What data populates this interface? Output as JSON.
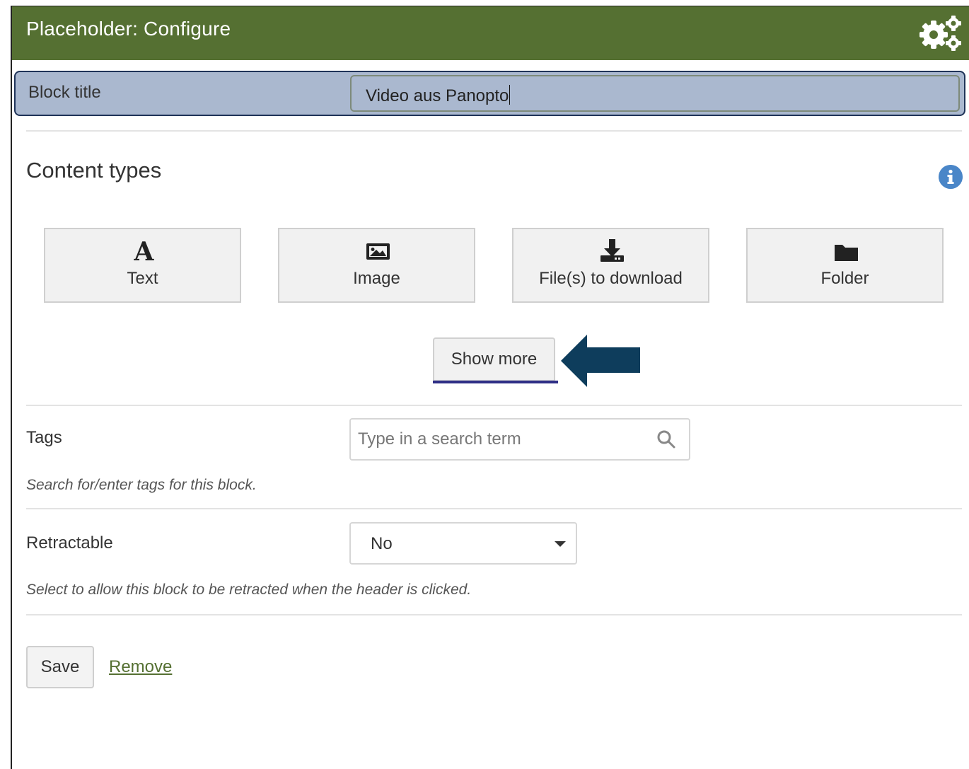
{
  "header": {
    "title": "Placeholder: Configure",
    "settings_icon": "gears-icon"
  },
  "block_title": {
    "label": "Block title",
    "value": "Video aus Panopto"
  },
  "content_types": {
    "heading": "Content types",
    "info_icon": "info-icon",
    "items": [
      {
        "label": "Text",
        "icon": "text-letter-icon"
      },
      {
        "label": "Image",
        "icon": "image-icon"
      },
      {
        "label": "File(s) to download",
        "icon": "download-icon"
      },
      {
        "label": "Folder",
        "icon": "folder-icon"
      }
    ],
    "show_more_label": "Show more",
    "annotation_arrow_color": "#0e3d5c"
  },
  "tags": {
    "label": "Tags",
    "placeholder": "Type in a search term",
    "help": "Search for/enter tags for this block."
  },
  "retractable": {
    "label": "Retractable",
    "value": "No",
    "help": "Select to allow this block to be retracted when the header is clicked."
  },
  "actions": {
    "save_label": "Save",
    "remove_label": "Remove"
  },
  "colors": {
    "header_bg": "#557032",
    "highlight_bg": "#aab8cf",
    "highlight_border": "#1f3358",
    "link": "#557032"
  }
}
